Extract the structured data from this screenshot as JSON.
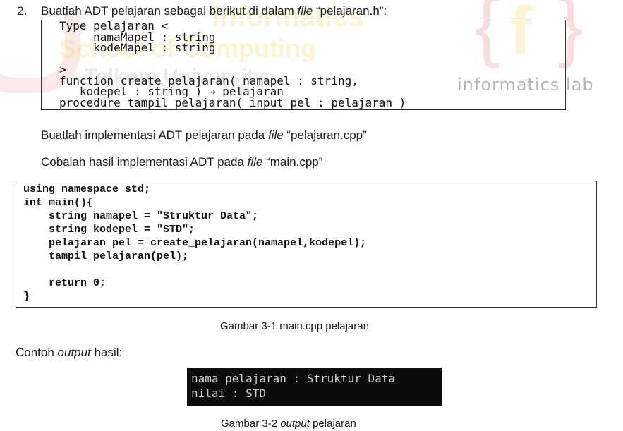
{
  "watermark": {
    "text_line1": "Informatics",
    "text_line2": "School of Computing",
    "text_line3": "Telkom University",
    "lab_text": "informatics lab"
  },
  "item": {
    "number": "2.",
    "text_before": "Buatlah ADT pelajaran sebagai berikut di dalam ",
    "text_italic": "file",
    "text_after": " “pelajaran.h”:"
  },
  "header_code": "Type pelajaran <\n     namaMapel : string\n     kodeMapel : string\n\n>\nfunction create_pelajaran( namapel : string,\n   kodepel : string ) → pelajaran\nprocedure tampil_pelajaran( input pel : pelajaran )",
  "instructions": [
    {
      "before": "Buatlah implementasi ADT pelajaran pada ",
      "italic": "file",
      "after": " “pelajaran.cpp”"
    },
    {
      "before": "Cobalah hasil implementasi ADT pada ",
      "italic": "file",
      "after": " “main.cpp”"
    }
  ],
  "main_code": "using namespace std;\nint main(){\n    string namapel = \"Struktur Data\";\n    string kodepel = \"STD\";\n    pelajaran pel = create_pelajaran(namapel,kodepel);\n    tampil_pelajaran(pel);\n\n    return 0;\n}",
  "caption1": "Gambar 3-1 main.cpp pelajaran",
  "output_label": {
    "before": "Contoh ",
    "italic": "output",
    "after": " hasil:"
  },
  "console_output": "nama pelajaran : Struktur Data\nnilai : STD",
  "caption2": {
    "before": "Gambar 3-2 ",
    "italic": "output",
    "after": " pelajaran"
  }
}
